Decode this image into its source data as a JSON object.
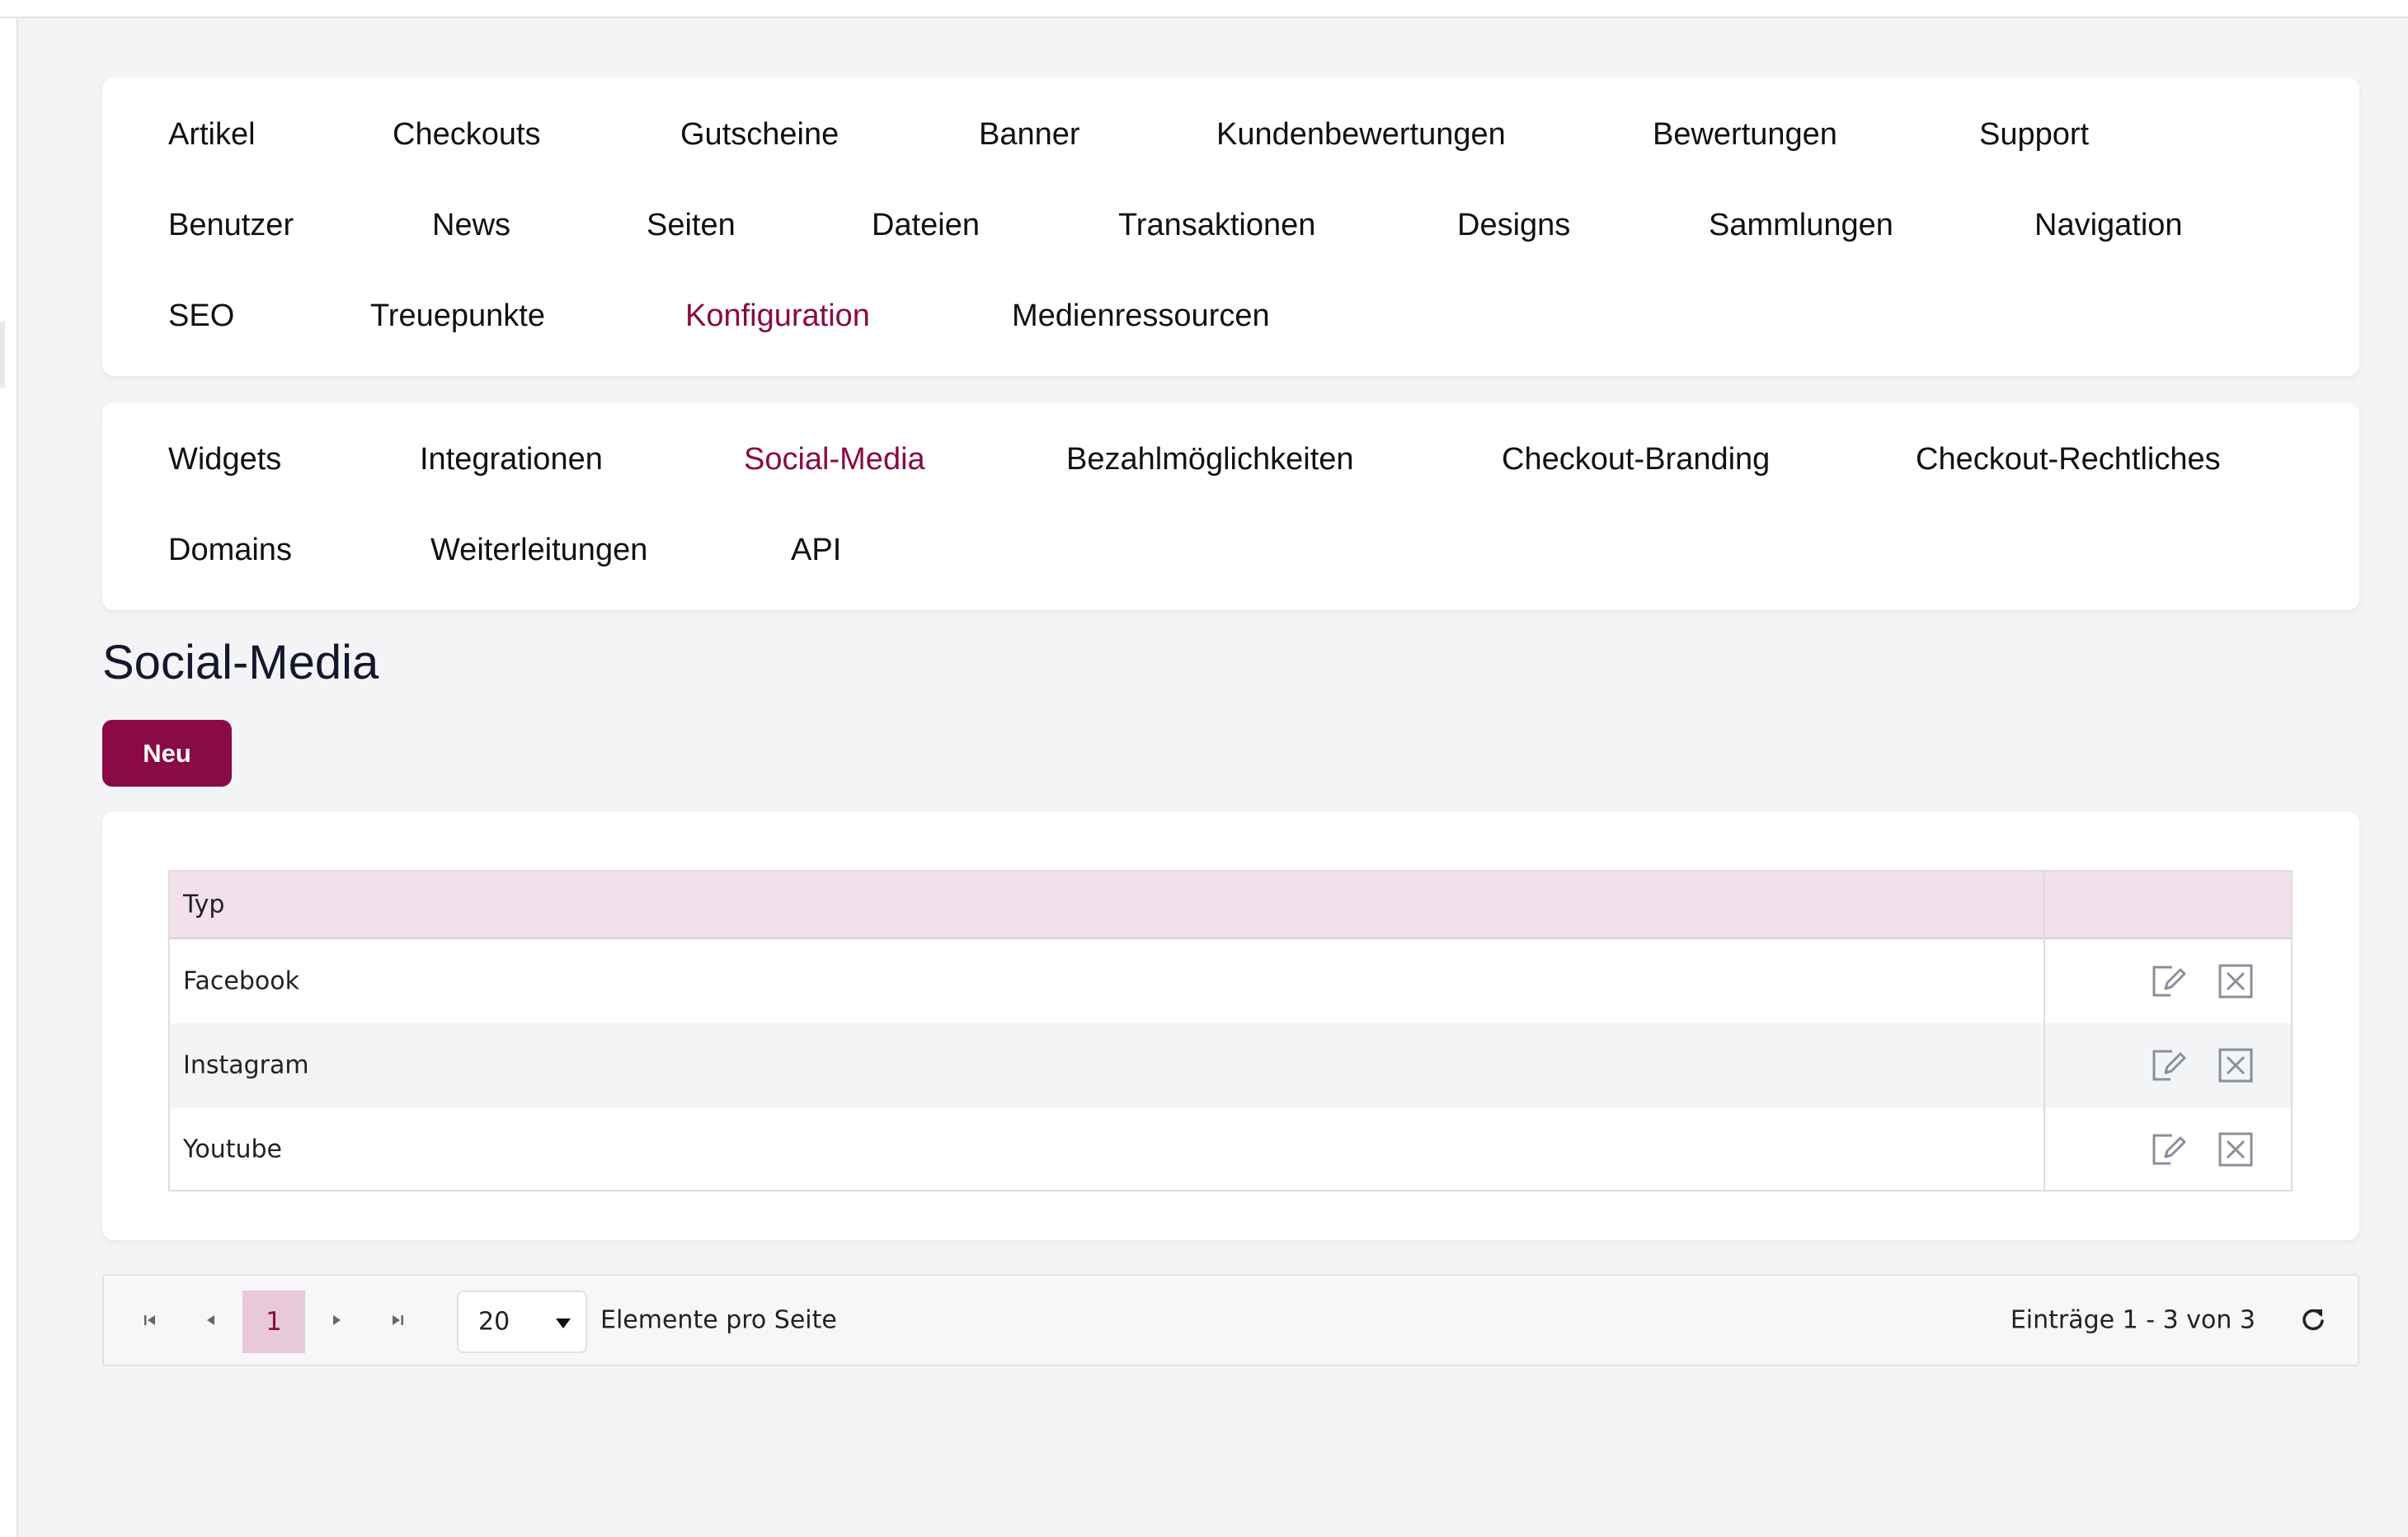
{
  "main_nav": {
    "items": [
      {
        "label": "Artikel"
      },
      {
        "label": "Checkouts"
      },
      {
        "label": "Gutscheine"
      },
      {
        "label": "Banner"
      },
      {
        "label": "Kundenbewertungen"
      },
      {
        "label": "Bewertungen"
      },
      {
        "label": "Support"
      },
      {
        "label": "Benutzer"
      },
      {
        "label": "News"
      },
      {
        "label": "Seiten"
      },
      {
        "label": "Dateien"
      },
      {
        "label": "Transaktionen"
      },
      {
        "label": "Designs"
      },
      {
        "label": "Sammlungen"
      },
      {
        "label": "Navigation"
      },
      {
        "label": "SEO"
      },
      {
        "label": "Treuepunkte"
      },
      {
        "label": "Konfiguration",
        "active": true
      },
      {
        "label": "Medienressourcen"
      }
    ]
  },
  "sub_nav": {
    "items": [
      {
        "label": "Widgets"
      },
      {
        "label": "Integrationen"
      },
      {
        "label": "Social-Media",
        "active": true
      },
      {
        "label": "Bezahlmöglichkeiten"
      },
      {
        "label": "Checkout-Branding"
      },
      {
        "label": "Checkout-Rechtliches"
      },
      {
        "label": "Domains"
      },
      {
        "label": "Weiterleitungen"
      },
      {
        "label": "API"
      }
    ]
  },
  "page": {
    "title": "Social-Media",
    "new_button": "Neu"
  },
  "grid": {
    "columns": [
      "Typ",
      ""
    ],
    "rows": [
      {
        "type": "Facebook",
        "actions": [
          "edit-icon",
          "delete-icon"
        ]
      },
      {
        "type": "Instagram",
        "actions": [
          "edit-icon",
          "delete-icon"
        ]
      },
      {
        "type": "Youtube",
        "actions": [
          "edit-icon",
          "delete-icon"
        ]
      }
    ]
  },
  "pager": {
    "current_page": "1",
    "page_size": "20",
    "page_size_label": "Elemente pro Seite",
    "info": "Einträge 1 - 3 von 3",
    "icons": [
      "first-page-icon",
      "prev-page-icon",
      "next-page-icon",
      "last-page-icon",
      "refresh-icon"
    ]
  },
  "colors": {
    "accent": "#8a0a46",
    "header_bg": "#f2e1eb",
    "page_bg": "#f3f4f6"
  }
}
